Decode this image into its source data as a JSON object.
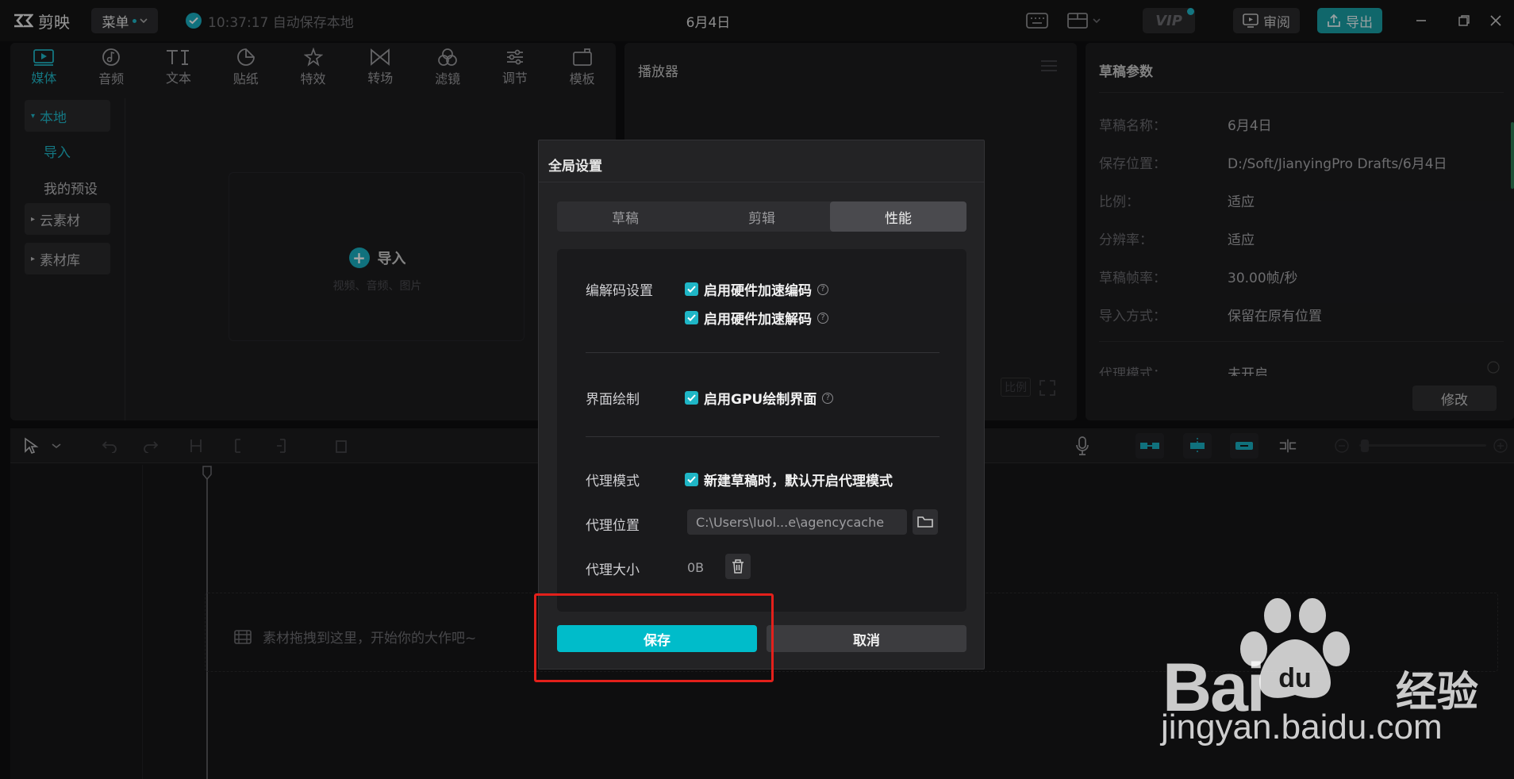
{
  "app": {
    "logo_text": "剪映",
    "menu_label": "菜单",
    "autosave_text": "10:37:17 自动保存本地",
    "project_title": "6月4日",
    "vip_label": "VIP",
    "review_label": "审阅",
    "export_label": "导出"
  },
  "media": {
    "tabs": [
      {
        "label": "媒体",
        "icon": "media-icon"
      },
      {
        "label": "音频",
        "icon": "audio-icon"
      },
      {
        "label": "文本",
        "icon": "text-icon"
      },
      {
        "label": "贴纸",
        "icon": "sticker-icon"
      },
      {
        "label": "特效",
        "icon": "effects-icon"
      },
      {
        "label": "转场",
        "icon": "transition-icon"
      },
      {
        "label": "滤镜",
        "icon": "filter-icon"
      },
      {
        "label": "调节",
        "icon": "adjust-icon"
      },
      {
        "label": "模板",
        "icon": "template-icon"
      }
    ],
    "sidebar": {
      "local": "本地",
      "import": "导入",
      "presets": "我的预设",
      "cloud": "云素材",
      "library": "素材库"
    },
    "import_label": "导入",
    "import_hint": "视频、音频、图片"
  },
  "player": {
    "title": "播放器",
    "ratio_label": "比例"
  },
  "draft": {
    "title": "草稿参数",
    "rows": [
      {
        "k": "草稿名称：",
        "v": "6月4日"
      },
      {
        "k": "保存位置：",
        "v": "D:/Soft/JianyingPro Drafts/6月4日"
      },
      {
        "k": "比例：",
        "v": "适应"
      },
      {
        "k": "分辨率：",
        "v": "适应"
      },
      {
        "k": "草稿帧率：",
        "v": "30.00帧/秒"
      },
      {
        "k": "导入方式：",
        "v": "保留在原有位置"
      },
      {
        "k": "代理模式：",
        "v": "未开启"
      }
    ],
    "modify_label": "修改"
  },
  "timeline": {
    "drop_hint": "素材拖拽到这里，开始你的大作吧~"
  },
  "dialog": {
    "title": "全局设置",
    "tabs": [
      "草稿",
      "剪辑",
      "性能"
    ],
    "active_tab": "性能",
    "codec_label": "编解码设置",
    "hw_encode": "启用硬件加速编码",
    "hw_decode": "启用硬件加速解码",
    "render_label": "界面绘制",
    "gpu_render": "启用GPU绘制界面",
    "proxy_mode_label": "代理模式",
    "proxy_mode_option": "新建草稿时，默认开启代理模式",
    "proxy_location_label": "代理位置",
    "proxy_location_value": "C:\\Users\\luol...e\\agencycache",
    "proxy_size_label": "代理大小",
    "proxy_size_value": "0B",
    "save_label": "保存",
    "cancel_label": "取消",
    "checks": {
      "hw_encode": true,
      "hw_decode": true,
      "gpu_render": true,
      "proxy_mode": true
    }
  },
  "watermark": {
    "brand": "Bai",
    "brand_du": "du",
    "brand_cn": "经验",
    "url": "jingyan.baidu.com"
  },
  "colors": {
    "accent": "#1fb6c6",
    "save_button": "#00bcca",
    "highlight": "#e3201b"
  }
}
